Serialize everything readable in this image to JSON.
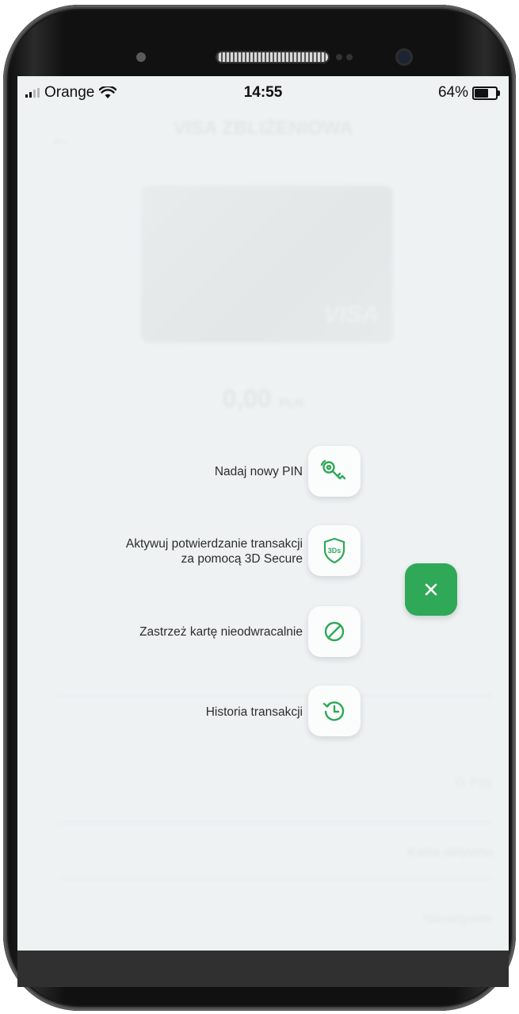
{
  "status_bar": {
    "carrier": "Orange",
    "time": "14:55",
    "battery": "64%"
  },
  "background": {
    "title": "VISA ZBLIŻENIOWA",
    "card_brand": "VISA",
    "balance_amount": "0,00",
    "balance_currency": "PLN",
    "rows": [
      {
        "value": "G Pay"
      },
      {
        "value": "Karta aktywna"
      },
      {
        "value": "Nieaktywne"
      }
    ]
  },
  "menu": {
    "items": [
      {
        "label": "Nadaj nowy PIN",
        "icon": "key-icon"
      },
      {
        "label_line1": "Aktywuj potwierdzanie transakcji",
        "label_line2": "za pomocą 3D Secure",
        "icon": "3ds-shield-icon",
        "icon_text": "3Ds"
      },
      {
        "label": "Zastrzeż kartę nieodwracalnie",
        "icon": "block-icon"
      },
      {
        "label": "Historia transakcji",
        "icon": "history-icon"
      }
    ],
    "close_icon": "close-icon"
  },
  "colors": {
    "accent": "#2fa858",
    "overlay_bg": "#eef2f3"
  }
}
